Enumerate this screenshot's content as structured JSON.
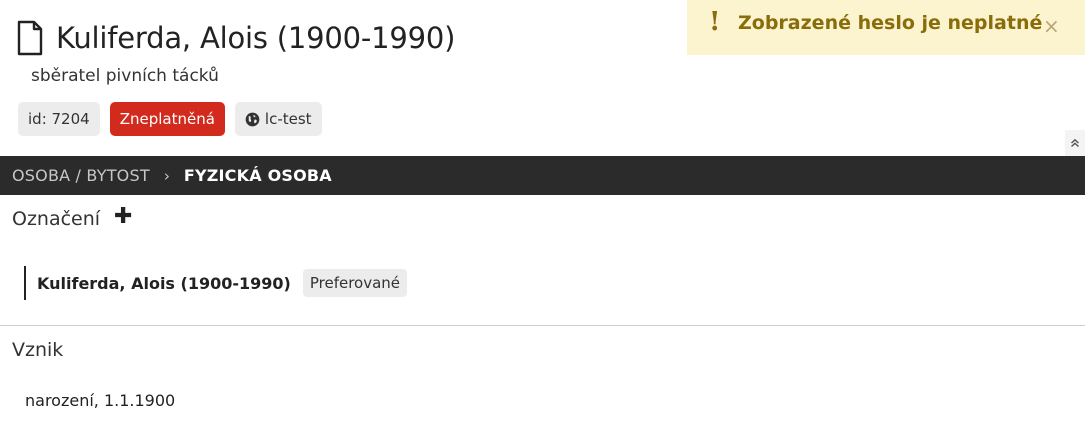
{
  "entity": {
    "icon": "document-icon",
    "title": "Kuliferda, Alois (1900-1990)",
    "subtitle": "sběratel pivních tácků"
  },
  "badges": {
    "id_label": "id: 7204",
    "status_label": "Zneplatněná",
    "status_color": "#d22b1e",
    "scope_icon": "globe-icon",
    "scope_label": "lc-test"
  },
  "alert": {
    "icon": "exclamation-icon",
    "message": "Zobrazené heslo je neplatné",
    "close_symbol": "×",
    "background": "#fcf3cf",
    "text_color": "#8a6d0b"
  },
  "collapse": {
    "icon": "chevron-double-up-icon",
    "symbol": "»"
  },
  "breadcrumb": {
    "parent": "OSOBA / BYTOST",
    "separator": "›",
    "current": "FYZICKÁ OSOBA"
  },
  "sections": {
    "designation": {
      "title": "Označení",
      "add_symbol": "✚",
      "items": [
        {
          "name": "Kuliferda, Alois (1900-1990)",
          "badge": "Preferované"
        }
      ]
    },
    "origin": {
      "title": "Vznik",
      "items": [
        {
          "text": "narození, 1.1.1900"
        }
      ]
    }
  }
}
